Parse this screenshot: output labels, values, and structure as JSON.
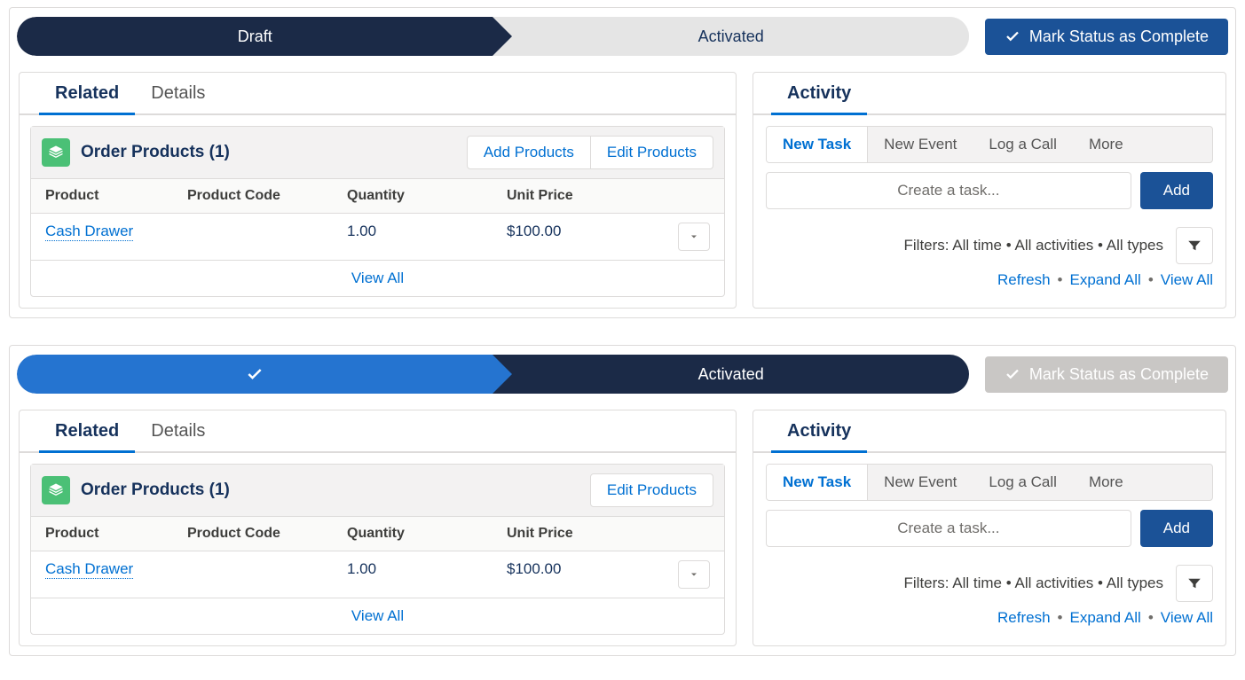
{
  "records": [
    {
      "path": {
        "stage1": "Draft",
        "stage2": "Activated",
        "stage1_state": "current",
        "stage2_state": "idle"
      },
      "mark_button": {
        "label": "Mark Status as Complete",
        "enabled": true
      },
      "left": {
        "tabs": {
          "related": "Related",
          "details": "Details",
          "active": "related"
        },
        "related": {
          "title": "Order Products (1)",
          "actions": {
            "add": "Add Products",
            "edit": "Edit Products",
            "show_add": true
          },
          "columns": {
            "product": "Product",
            "code": "Product Code",
            "qty": "Quantity",
            "price": "Unit Price"
          },
          "rows": [
            {
              "product": "Cash Drawer",
              "code": "",
              "qty": "1.00",
              "price": "$100.00"
            }
          ],
          "view_all": "View All"
        }
      },
      "right": {
        "heading": "Activity",
        "subtabs": {
          "new_task": "New Task",
          "new_event": "New Event",
          "log_call": "Log a Call",
          "more": "More"
        },
        "task_placeholder": "Create a task...",
        "add_label": "Add",
        "filter_text": "Filters: All time • All activities • All types",
        "links": {
          "refresh": "Refresh",
          "expand": "Expand All",
          "view_all": "View All"
        }
      }
    },
    {
      "path": {
        "stage1": "",
        "stage2": "Activated",
        "stage1_state": "complete",
        "stage2_state": "current"
      },
      "mark_button": {
        "label": "Mark Status as Complete",
        "enabled": false
      },
      "left": {
        "tabs": {
          "related": "Related",
          "details": "Details",
          "active": "related"
        },
        "related": {
          "title": "Order Products (1)",
          "actions": {
            "add": "",
            "edit": "Edit Products",
            "show_add": false
          },
          "columns": {
            "product": "Product",
            "code": "Product Code",
            "qty": "Quantity",
            "price": "Unit Price"
          },
          "rows": [
            {
              "product": "Cash Drawer",
              "code": "",
              "qty": "1.00",
              "price": "$100.00"
            }
          ],
          "view_all": "View All"
        }
      },
      "right": {
        "heading": "Activity",
        "subtabs": {
          "new_task": "New Task",
          "new_event": "New Event",
          "log_call": "Log a Call",
          "more": "More"
        },
        "task_placeholder": "Create a task...",
        "add_label": "Add",
        "filter_text": "Filters: All time • All activities • All types",
        "links": {
          "refresh": "Refresh",
          "expand": "Expand All",
          "view_all": "View All"
        }
      }
    }
  ]
}
